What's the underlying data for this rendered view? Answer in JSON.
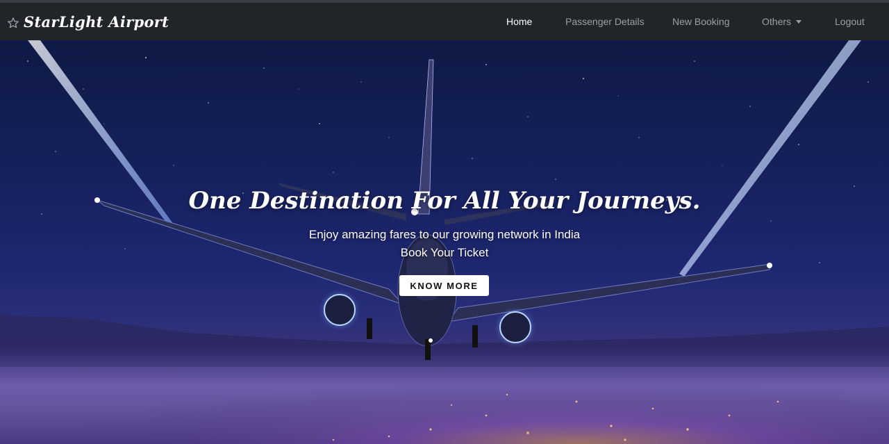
{
  "brand": {
    "name": "StarLight Airport",
    "icon": "star-icon"
  },
  "nav": {
    "home": "Home",
    "passenger_details": "Passenger Details",
    "new_booking": "New Booking",
    "others": "Others",
    "logout": "Logout",
    "active": "Home"
  },
  "hero": {
    "title": "One Destination For All Your Journeys.",
    "subtitle_line1": "Enjoy amazing fares to our growing network in India",
    "subtitle_line2": "Book Your Ticket",
    "cta_label": "KNOW MORE"
  },
  "colors": {
    "navbar_bg": "#212529",
    "nav_active": "#ffffff",
    "nav_inactive": "rgba(255,255,255,0.55)",
    "hero_sky": "#15205a",
    "button_bg": "#ffffff"
  }
}
